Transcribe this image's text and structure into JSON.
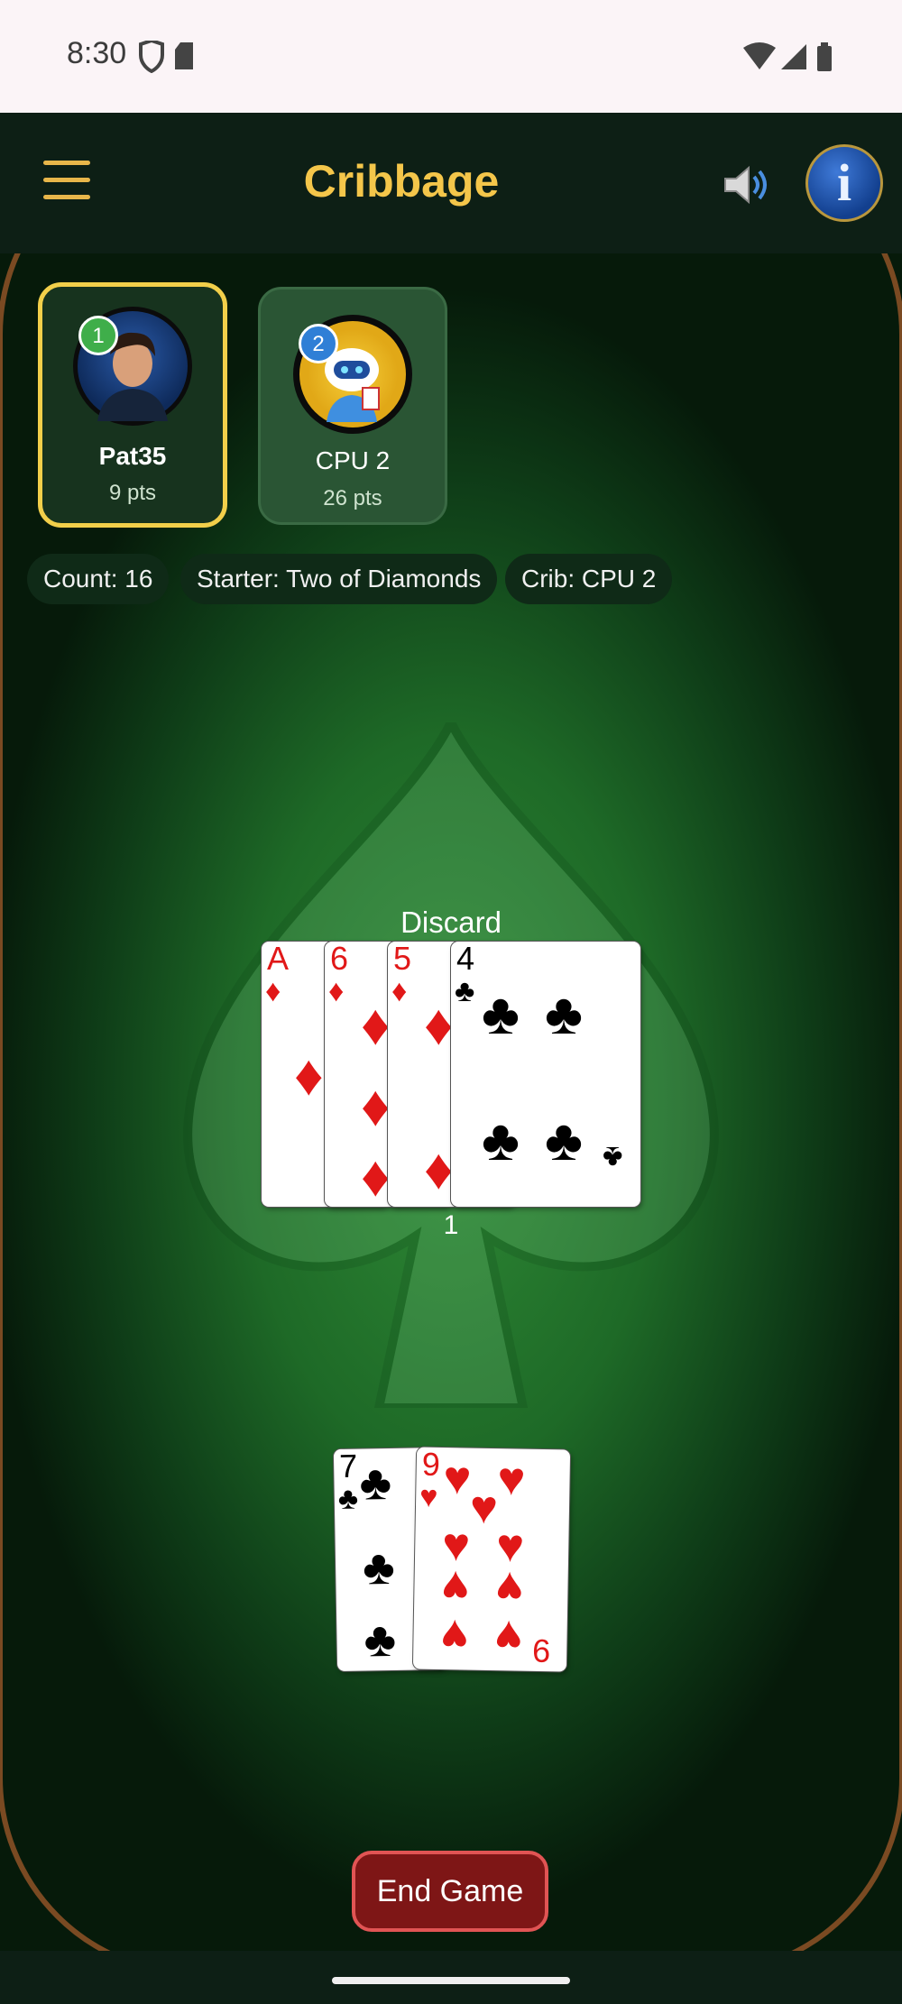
{
  "status_bar": {
    "time": "8:30"
  },
  "app_bar": {
    "title": "Cribbage",
    "info_glyph": "i"
  },
  "players": [
    {
      "seat": "1",
      "name": "Pat35",
      "points": "9 pts",
      "active": true
    },
    {
      "seat": "2",
      "name": "CPU 2",
      "points": "26 pts",
      "active": false
    }
  ],
  "info_chips": {
    "count": "Count: 16",
    "starter": "Starter: Two of Diamonds",
    "crib": "Crib: CPU 2"
  },
  "discard": {
    "label": "Discard",
    "count": "1",
    "cards": [
      {
        "rank": "A",
        "suit": "♦",
        "color": "#e11818"
      },
      {
        "rank": "6",
        "suit": "♦",
        "color": "#e11818"
      },
      {
        "rank": "5",
        "suit": "♦",
        "color": "#e11818"
      },
      {
        "rank": "4",
        "suit": "♣",
        "color": "#000000"
      }
    ]
  },
  "hand": {
    "cards": [
      {
        "rank": "7",
        "suit": "♣",
        "color": "#000000"
      },
      {
        "rank": "9",
        "suit": "♥",
        "color": "#e11818"
      }
    ]
  },
  "actions": {
    "end_game": "End Game"
  },
  "colors": {
    "accent_gold": "#f4c64a",
    "felt": "#1e6a27",
    "end_game_bg": "#7e1616"
  }
}
